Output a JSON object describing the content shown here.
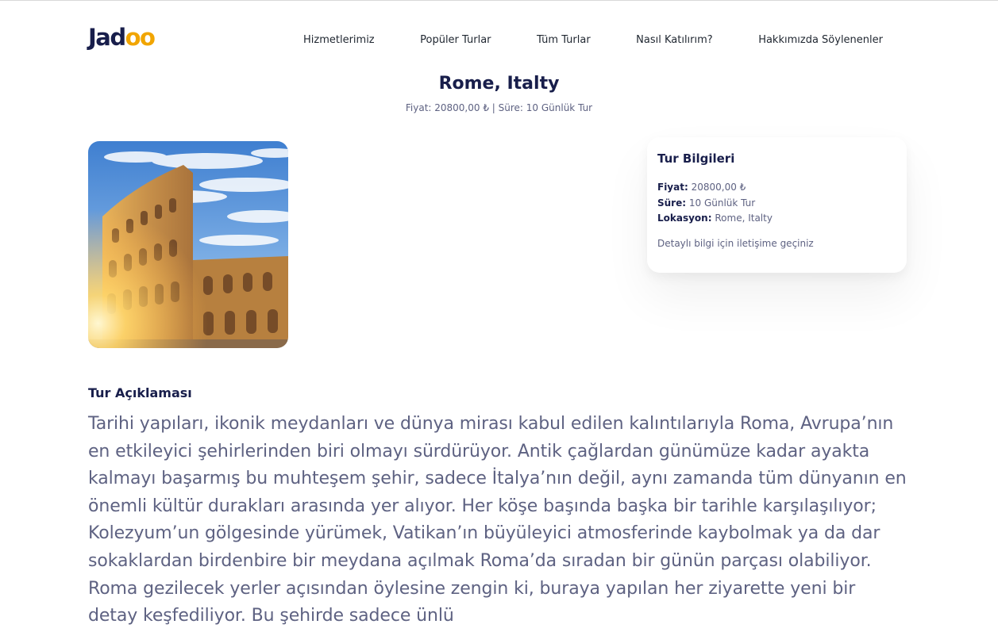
{
  "header": {
    "logo_main": "Jad",
    "logo_accent": "oo",
    "nav": [
      {
        "label": "Hizmetlerimiz"
      },
      {
        "label": "Popüler Turlar"
      },
      {
        "label": "Tüm Turlar"
      },
      {
        "label": "Nasıl Katılırım?"
      },
      {
        "label": "Hakkımızda Söylenenler"
      }
    ]
  },
  "tour": {
    "title": "Rome, Italty",
    "subtitle": "Fiyat: 20800,00 ₺ | Süre: 10 Günlük Tur",
    "image_subject": "colosseum-photo"
  },
  "info_card": {
    "title": "Tur Bilgileri",
    "price_label": "Fiyat:",
    "price_value": "20800,00 ₺",
    "duration_label": "Süre:",
    "duration_value": "10 Günlük Tur",
    "location_label": "Lokasyon:",
    "location_value": "Rome, Italty",
    "note": "Detaylı bilgi için iletişime geçiniz"
  },
  "description": {
    "heading": "Tur Açıklaması",
    "text": "Tarihi yapıları, ikonik meydanları ve dünya mirası kabul edilen kalıntılarıyla Roma, Avrupa’nın en etkileyici şehirlerinden biri olmayı sürdürüyor. Antik çağlardan günümüze kadar ayakta kalmayı başarmış bu muhteşem şehir, sadece İtalya’nın değil, aynı zamanda tüm dünyanın en önemli kültür durakları arasında yer alıyor. Her köşe başında başka bir tarihle karşılaşılıyor; Kolezyum’un gölgesinde yürümek, Vatikan’ın büyüleyici atmosferinde kaybolmak ya da dar sokaklardan birdenbire bir meydana açılmak Roma’da sıradan bir günün parçası olabiliyor. Roma gezilecek yerler açısından öylesine zengin ki, buraya yapılan her ziyarette yeni bir detay keşfediliyor. Bu şehirde sadece ünlü"
  },
  "colors": {
    "primary": "#181e4b",
    "accent": "#f1a501",
    "text_muted": "#5e6282"
  }
}
